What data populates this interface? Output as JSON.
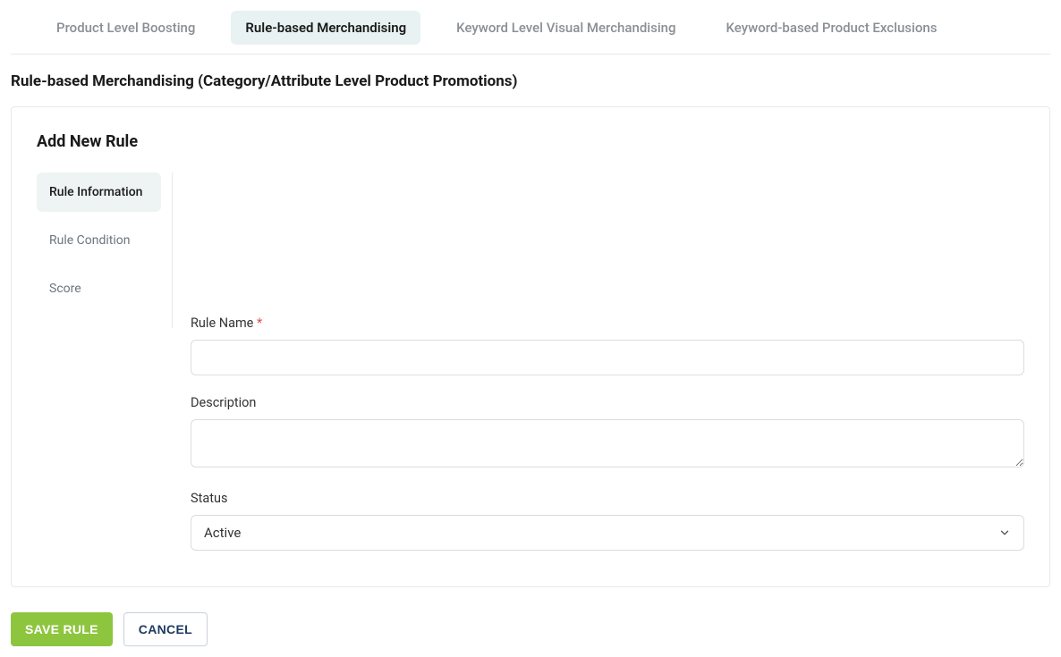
{
  "topTabs": {
    "items": [
      {
        "label": "Product Level Boosting",
        "active": false
      },
      {
        "label": "Rule-based Merchandising",
        "active": true
      },
      {
        "label": "Keyword Level Visual Merchandising",
        "active": false
      },
      {
        "label": "Keyword-based Product Exclusions",
        "active": false
      }
    ]
  },
  "sectionTitle": "Rule-based Merchandising (Category/Attribute Level Product Promotions)",
  "card": {
    "title": "Add New Rule",
    "sideTabs": [
      {
        "label": "Rule Information",
        "active": true
      },
      {
        "label": "Rule Condition",
        "active": false
      },
      {
        "label": "Score",
        "active": false
      }
    ],
    "form": {
      "ruleName": {
        "label": "Rule Name",
        "requiredMark": "*",
        "value": ""
      },
      "description": {
        "label": "Description",
        "value": ""
      },
      "status": {
        "label": "Status",
        "selected": "Active"
      }
    }
  },
  "actions": {
    "saveLabel": "SAVE RULE",
    "cancelLabel": "CANCEL"
  }
}
